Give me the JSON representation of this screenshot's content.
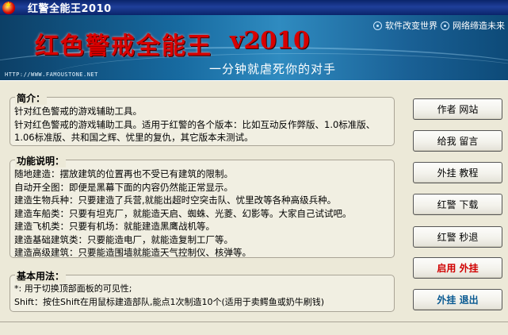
{
  "window": {
    "title": "红警全能王2010"
  },
  "banner": {
    "logo": "红色警戒全能王",
    "version": "v2010",
    "slogan": "一分钟就虐死你的对手",
    "url": "HTTP://WWW.FAMOUSTONE.NET",
    "link1": "软件改变世界",
    "link2": "网络缔造未来"
  },
  "intro": {
    "legend": "简介：",
    "lines": [
      "针对红色警戒的游戏辅助工具。",
      "针对红色警戒的游戏辅助工具。适用于红警的各个版本：比如互动反作弊版、1.0标准版、",
      "1.06标准版、共和国之辉、忧里的复仇，其它版本未测试。"
    ]
  },
  "functions": {
    "legend": "功能说明：",
    "lines": [
      "随地建造：摆放建筑的位置再也不受已有建筑的限制。",
      "自动开全图：即便是黑幕下面的内容仍然能正常显示。",
      "建造生物兵种：只要建造了兵营,就能出超时空突击队、忧里改等各种高级兵种。",
      "建造车船类：只要有坦克厂，就能造天启、蜘蛛、光菱、幻影等。大家自己试试吧。",
      "建造飞机类：只要有机场：就能建造黑鹰战机等。",
      "建造基础建筑类：只要能造电厂，就能造复制工厂等。",
      "建造高级建筑：只要能造围墙就能造天气控制仪、核弹等。"
    ]
  },
  "usage": {
    "legend": "基本用法：",
    "lines": [
      "*: 用于切换顶部面板的可见性;",
      "Shift：按住Shift在用鼠标建造部队,能点1次制造10个(适用于卖鳄鱼或奶牛刷钱)"
    ]
  },
  "buttons": {
    "author_site": "作者 网站",
    "message": "给我 留言",
    "tutorial": "外挂 教程",
    "download": "红警 下载",
    "hide": "红警 秒退",
    "enable": "启用 外挂",
    "exit": "外挂 退出"
  },
  "colors": {
    "title_bar": "#0a246a",
    "accent_red": "#d00000",
    "accent_blue": "#0a5a92",
    "banner_blue": "#176aa0"
  }
}
